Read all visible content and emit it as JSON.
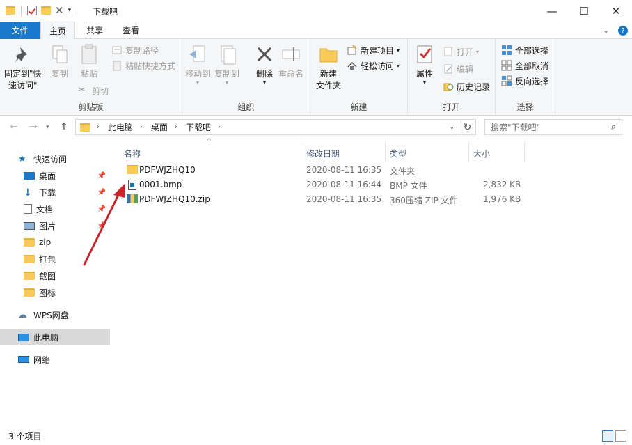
{
  "window": {
    "title": "下载吧"
  },
  "ribbon_tabs": {
    "file": "文件",
    "home": "主页",
    "share": "共享",
    "view": "查看"
  },
  "ribbon": {
    "clipboard": {
      "label": "剪贴板",
      "pin_quick_access": "固定到\"快",
      "pin_quick_access_2": "速访问\"",
      "copy": "复制",
      "paste": "粘贴",
      "copy_path": "复制路径",
      "paste_shortcut": "粘贴快捷方式",
      "cut": "剪切"
    },
    "organize": {
      "label": "组织",
      "move_to": "移动到",
      "copy_to": "复制到",
      "delete": "删除",
      "rename": "重命名"
    },
    "new": {
      "label": "新建",
      "new_folder": "新建",
      "new_folder_2": "文件夹",
      "new_item": "新建项目",
      "easy_access": "轻松访问"
    },
    "open": {
      "label": "打开",
      "properties": "属性",
      "open": "打开",
      "edit": "编辑",
      "history": "历史记录"
    },
    "select": {
      "label": "选择",
      "select_all": "全部选择",
      "select_none": "全部取消",
      "invert": "反向选择"
    }
  },
  "address": {
    "crumbs": [
      "此电脑",
      "桌面",
      "下载吧"
    ],
    "search_placeholder": "搜索\"下载吧\""
  },
  "nav_pane": {
    "quick_access": "快速访问",
    "items": [
      "桌面",
      "下载",
      "文档",
      "图片",
      "zip",
      "打包",
      "截图",
      "图标"
    ],
    "wps": "WPS网盘",
    "this_pc": "此电脑",
    "network": "网络"
  },
  "columns": {
    "name": "名称",
    "modified": "修改日期",
    "type": "类型",
    "size": "大小"
  },
  "files": [
    {
      "name": "PDFWJZHQ10",
      "modified": "2020-08-11 16:35",
      "type": "文件夹",
      "size": ""
    },
    {
      "name": "0001.bmp",
      "modified": "2020-08-11 16:44",
      "type": "BMP 文件",
      "size": "2,832 KB"
    },
    {
      "name": "PDFWJZHQ10.zip",
      "modified": "2020-08-11 16:35",
      "type": "360压缩 ZIP 文件",
      "size": "1,976 KB"
    }
  ],
  "status": {
    "count": "3 个项目"
  },
  "colors": {
    "accent": "#1979ca",
    "folder": "#f8cb58",
    "arrow": "#c9262c"
  }
}
